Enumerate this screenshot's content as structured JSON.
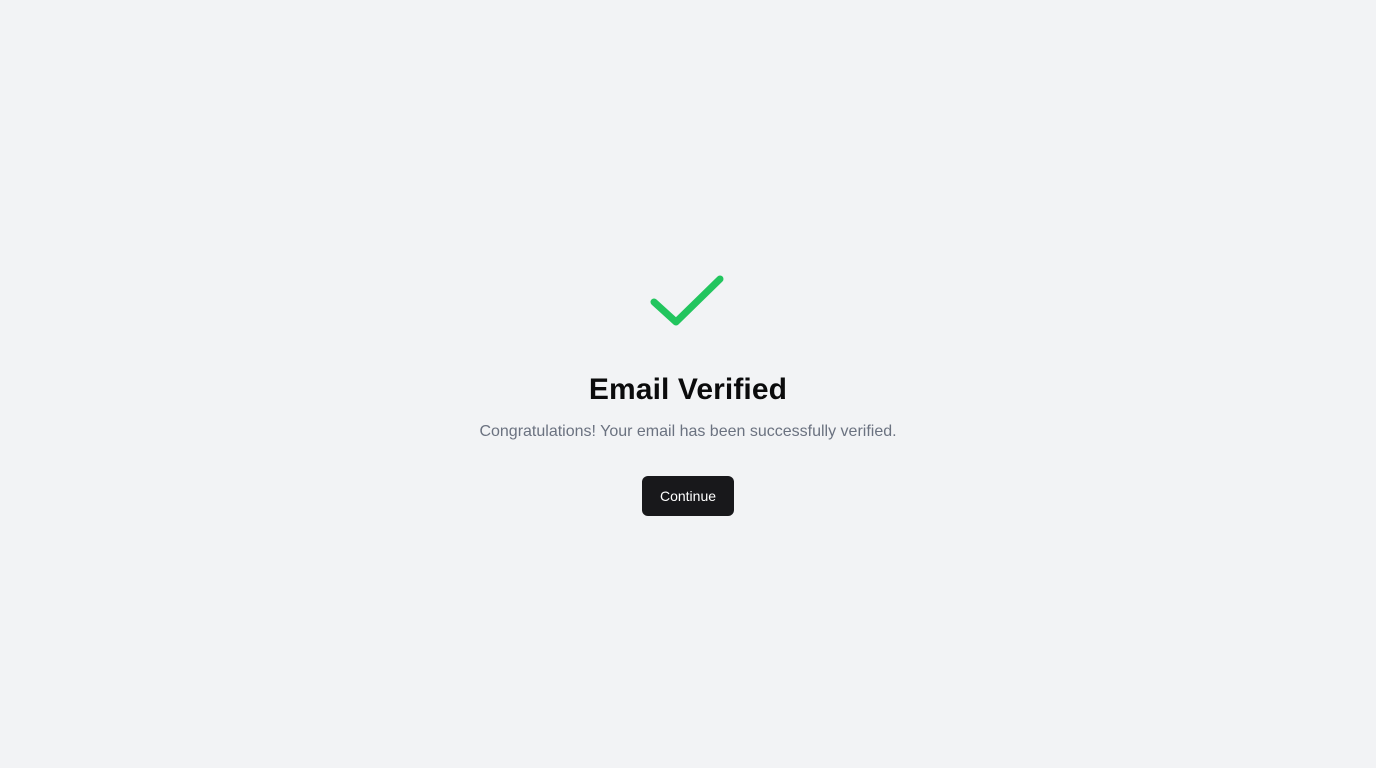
{
  "verification": {
    "icon": "check-icon",
    "icon_color": "#22c55e",
    "title": "Email Verified",
    "message": "Congratulations! Your email has been successfully verified.",
    "continue_label": "Continue"
  },
  "colors": {
    "background": "#f2f3f5",
    "title": "#0b0b0c",
    "message": "#6b7280",
    "button": "#18181b",
    "button_text": "#ffffff"
  }
}
